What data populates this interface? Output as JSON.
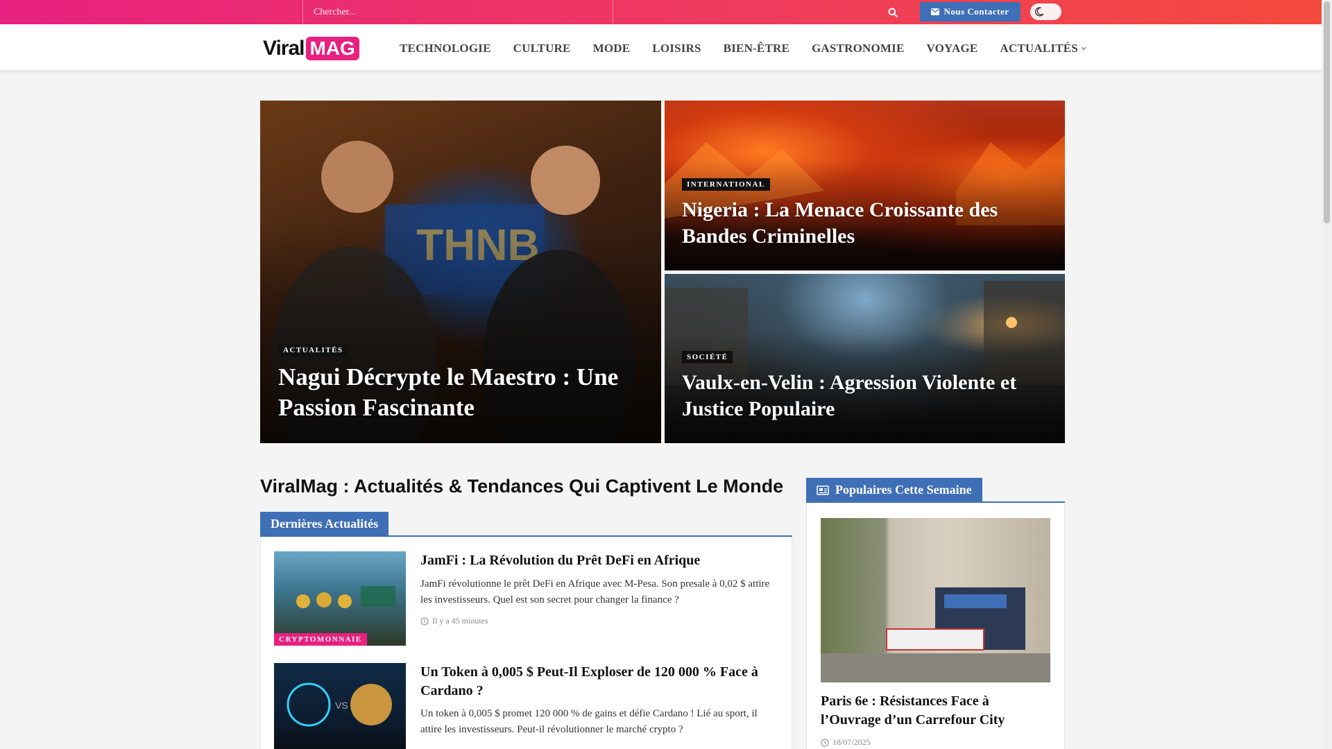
{
  "topbar": {
    "search_placeholder": "Chercher...",
    "search_icon": "search-icon",
    "contact_label": "Nous Contacter",
    "contact_icon": "envelope-icon",
    "theme_icon": "moon-icon"
  },
  "nav": {
    "logo_viral": "Viral",
    "logo_mag": "MAG",
    "items": [
      {
        "label": "TECHNOLOGIE"
      },
      {
        "label": "CULTURE"
      },
      {
        "label": "MODE"
      },
      {
        "label": "LOISIRS"
      },
      {
        "label": "BIEN-ÊTRE"
      },
      {
        "label": "GASTRONOMIE"
      },
      {
        "label": "VOYAGE"
      },
      {
        "label": "ACTUALITÉS",
        "has_dropdown": true
      }
    ]
  },
  "hero": [
    {
      "category": "ACTUALITÉS",
      "title": "Nagui Décrypte le Maestro : Une Passion Fascinante"
    },
    {
      "category": "INTERNATIONAL",
      "title": "Nigeria : La Menace Croissante des Bandes Criminelles"
    },
    {
      "category": "SOCIÉTÉ",
      "title": "Vaulx-en-Velin : Agression Violente et Justice Populaire"
    }
  ],
  "main": {
    "site_title": "ViralMag : Actualités & Tendances Qui Captivent Le Monde",
    "latest_heading": "Dernières Actualités",
    "posts": [
      {
        "category": "CRYPTOMONNAIE",
        "title": "JamFi : La Révolution du Prêt DeFi en Afrique",
        "excerpt": "JamFi révolutionne le prêt DeFi en Afrique avec M-Pesa. Son presale à 0,02 $ attire les investisseurs. Quel est son secret pour changer la finance ?",
        "time": "Il y a 45 minutes"
      },
      {
        "category": "",
        "title": "Un Token à 0,005 $ Peut-Il Exploser de 120 000 % Face à Cardano ?",
        "excerpt": "Un token à 0,005 $ promet 120 000 % de gains et défie Cardano ! Lié au sport, il attire les investisseurs. Peut-il révolutionner le marché crypto ?",
        "time": ""
      }
    ]
  },
  "sidebar": {
    "popular_heading": "Populaires Cette Semaine",
    "popular_icon": "newspaper-icon",
    "popular_post": {
      "title": "Paris 6e : Résistances Face à l’Ouvrage d’un Carrefour City",
      "date": "18/07/2025"
    }
  },
  "colors": {
    "accent_pink": "#e8207f",
    "accent_blue": "#3f6fb6",
    "topbar_end": "#f44a3c"
  }
}
